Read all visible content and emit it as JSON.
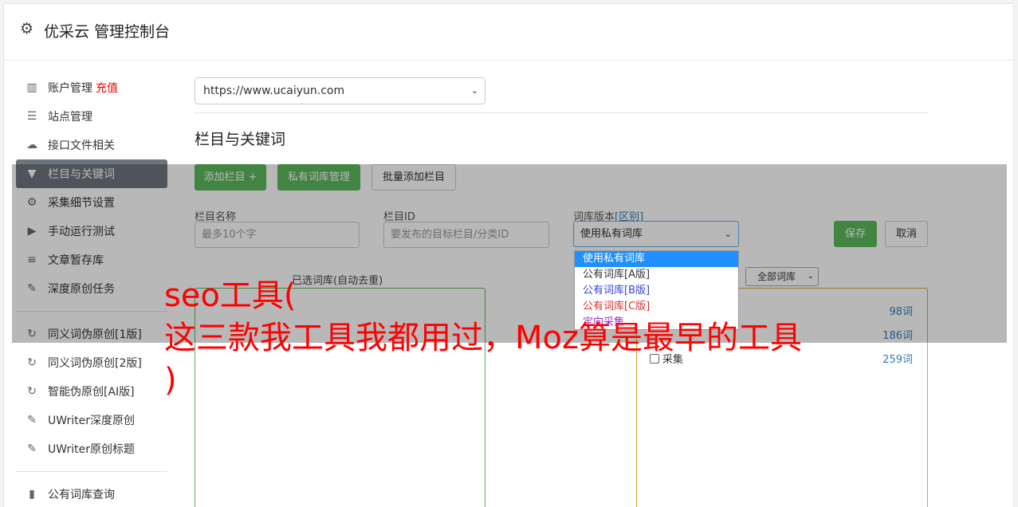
{
  "header": {
    "title": "优采云 管理控制台",
    "icon": "gear-icon"
  },
  "sidebar": {
    "items": [
      {
        "label": "账户管理",
        "badge": "充值",
        "icon": "bar-chart-icon"
      },
      {
        "label": "站点管理",
        "icon": "server-icon"
      },
      {
        "label": "接口文件相关",
        "icon": "cloud-upload-icon"
      },
      {
        "label": "栏目与关键词",
        "icon": "filter-icon",
        "active": true
      },
      {
        "label": "采集细节设置",
        "icon": "gears-icon"
      },
      {
        "label": "手动运行测试",
        "icon": "play-icon"
      },
      {
        "label": "文章暂存库",
        "icon": "database-icon"
      },
      {
        "label": "深度原创任务",
        "icon": "edit-icon"
      },
      {
        "label": "同义词伪原创[1版]",
        "icon": "refresh-icon"
      },
      {
        "label": "同义词伪原创[2版]",
        "icon": "refresh-icon"
      },
      {
        "label": "智能伪原创[AI版]",
        "icon": "refresh-icon"
      },
      {
        "label": "UWriter深度原创",
        "icon": "edit-icon"
      },
      {
        "label": "UWriter原创标题",
        "icon": "edit-icon"
      },
      {
        "label": "公有词库查询",
        "icon": "book-icon"
      }
    ]
  },
  "main": {
    "site_select": "https://www.ucaiyun.com",
    "section_title": "栏目与关键词",
    "buttons": {
      "add_column": "添加栏目 +",
      "private_lib": "私有词库管理",
      "batch_add": "批量添加栏目",
      "save": "保存",
      "cancel": "取消"
    },
    "form": {
      "column_name_label": "栏目名称",
      "column_name_placeholder": "最多10个字",
      "column_id_label": "栏目ID",
      "column_id_placeholder": "要发布的目标栏目/分类ID",
      "lib_version_label": "词库版本",
      "lib_version_diff": "[区别]",
      "lib_version_value": "使用私有词库"
    },
    "dropdown_options": [
      "使用私有词库",
      "公有词库[A版]",
      "公有词库[B版]",
      "公有词库[C版]",
      "定向采集"
    ],
    "selected_box_title": "已选词库(自动去重)",
    "filter_select": "全部词库",
    "library_rows": [
      {
        "name": "",
        "count": "98词"
      },
      {
        "name": "",
        "count": "186词"
      },
      {
        "name": "采集",
        "count": "259词"
      }
    ]
  },
  "banner": {
    "line1": "seo工具(",
    "line2": "这三款我工具我都用过，Moz算是最早的工具",
    "line3": ")"
  },
  "colors": {
    "active_nav": "#6c757d",
    "green": "#5cb85c",
    "orange": "#e2a13a",
    "banner": "#ff0000",
    "recharge": "#ee0000"
  }
}
